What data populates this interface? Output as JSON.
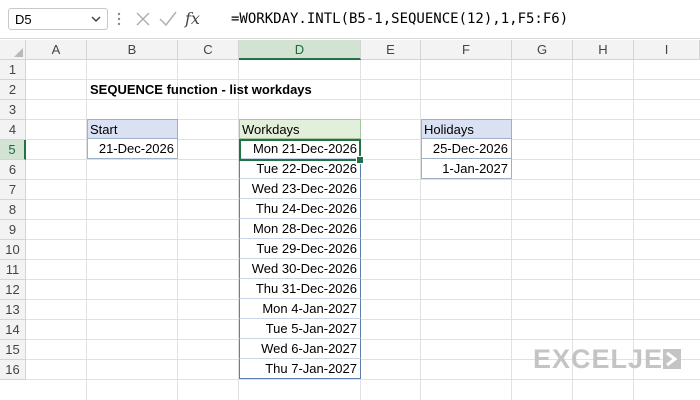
{
  "formula_bar": {
    "name_box": "D5",
    "formula": "=WORKDAY.INTL(B5-1,SEQUENCE(12),1,F5:F6)",
    "fx_label": "fx"
  },
  "columns": [
    "A",
    "B",
    "C",
    "D",
    "E",
    "F",
    "G",
    "H",
    "I"
  ],
  "active_column": "D",
  "rows": [
    "1",
    "2",
    "3",
    "4",
    "5",
    "6",
    "7",
    "8",
    "9",
    "10",
    "11",
    "12",
    "13",
    "14",
    "15",
    "16"
  ],
  "active_row": "5",
  "sheet": {
    "title": "SEQUENCE function - list workdays",
    "start": {
      "header": "Start",
      "value": "21-Dec-2026"
    },
    "workdays": {
      "header": "Workdays",
      "values": [
        "Mon 21-Dec-2026",
        "Tue 22-Dec-2026",
        "Wed 23-Dec-2026",
        "Thu 24-Dec-2026",
        "Mon 28-Dec-2026",
        "Tue 29-Dec-2026",
        "Wed 30-Dec-2026",
        "Thu 31-Dec-2026",
        "Mon 4-Jan-2027",
        "Tue 5-Jan-2027",
        "Wed 6-Jan-2027",
        "Thu 7-Jan-2027"
      ]
    },
    "holidays": {
      "header": "Holidays",
      "values": [
        "25-Dec-2026",
        "1-Jan-2027"
      ]
    }
  },
  "branding": {
    "logo_text": "EXCELJET"
  },
  "colors": {
    "accent": "#217346",
    "header_blue": "#d9e1f2",
    "header_green": "#e2efda"
  }
}
